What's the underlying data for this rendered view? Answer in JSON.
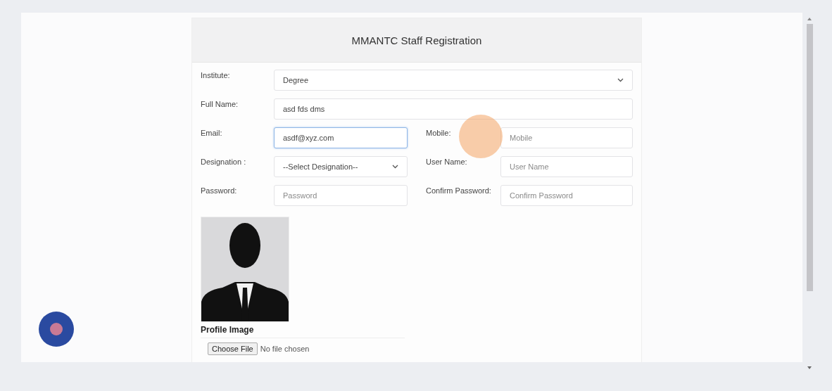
{
  "form": {
    "title": "MMANTC Staff Registration",
    "rows": [
      [
        {
          "kind": "select",
          "label": "Institute:",
          "value": "Degree",
          "focused": false
        }
      ],
      [
        {
          "kind": "text",
          "label": "Full Name:",
          "value": "asd fds dms",
          "focused": false
        }
      ],
      [
        {
          "kind": "text",
          "label": "Email:",
          "value": "asdf@xyz.com",
          "focused": true
        },
        {
          "kind": "text",
          "label": "Mobile:",
          "placeholder": "Mobile",
          "focused": false
        }
      ],
      [
        {
          "kind": "select",
          "label": "Designation :",
          "value": "--Select Designation--",
          "focused": false
        },
        {
          "kind": "text",
          "label": "User Name:",
          "placeholder": "User Name",
          "focused": false
        }
      ],
      [
        {
          "kind": "text",
          "label": "Password:",
          "placeholder": "Password",
          "focused": false
        },
        {
          "kind": "text",
          "label": "Confirm Password:",
          "placeholder": "Confirm Password",
          "focused": false
        }
      ]
    ],
    "profile_image": {
      "label": "Profile Image",
      "button": "Choose File",
      "status": "No file chosen"
    }
  }
}
